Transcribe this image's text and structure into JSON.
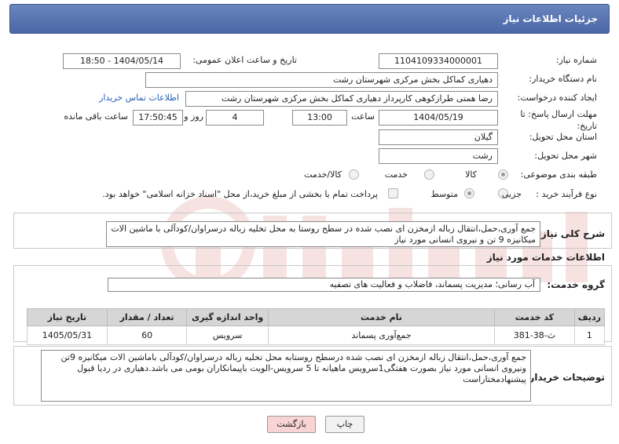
{
  "header": {
    "title": "جزئیات اطلاعات نیاز"
  },
  "form": {
    "need_number_label": "شماره نیاز:",
    "need_number": "1104109334000001",
    "announce_label": "تاریخ و ساعت اعلان عمومی:",
    "announce_value": "1404/05/14 - 18:50",
    "buyer_org_label": "نام دستگاه خریدار:",
    "buyer_org": "دهیاری کماکل بخش مرکزی شهرستان رشت",
    "creator_label": "ایجاد کننده درخواست:",
    "creator": "رضا همتی طرازکوهی کارپرداز دهیاری کماکل بخش مرکزی شهرستان رشت",
    "contact_link": "اطلاعات تماس خریدار",
    "deadline_label": "مهلت ارسال پاسخ: تا تاریخ:",
    "deadline_date": "1404/05/19",
    "time_label": "ساعت",
    "deadline_time": "13:00",
    "days_value": "4",
    "days_label": "روز و",
    "remaining_time": "17:50:45",
    "remaining_label": "ساعت باقی مانده",
    "province_label": "استان محل تحویل:",
    "province": "گیلان",
    "city_label": "شهر محل تحویل:",
    "city": "رشت",
    "category_label": "طبقه بندی موضوعی:",
    "category_options": [
      "کالا",
      "خدمت",
      "کالا/خدمت"
    ],
    "process_label": "نوع فرآیند خرید :",
    "process_options": [
      "جزیی",
      "متوسط"
    ],
    "payment_note": "پرداخت تمام یا بخشی از مبلغ خرید،از محل \"اسناد خزانه اسلامی\" خواهد بود."
  },
  "summary": {
    "label": "شرح کلی نیاز:",
    "text": "جمع آوری،حمل،انتقال زباله ازمخزن ای نصب شده در سطح روستا به محل تخلیه زباله درسراوان/کودآلی با ماشین الات میکانیزه 9 تن و نیروی انسانی مورد نیاز"
  },
  "services": {
    "section_title": "اطلاعات خدمات مورد نیاز",
    "group_label": "گروه خدمت:",
    "group_value": "آب رسانی؛ مدیریت پسماند، فاضلاب و فعالیت های تصفیه",
    "columns": [
      "ردیف",
      "کد خدمت",
      "نام خدمت",
      "واحد اندازه گیری",
      "تعداد / مقدار",
      "تاریخ نیاز"
    ],
    "rows": [
      {
        "index": "1",
        "code": "ث-38-381",
        "name": "جمع‌آوری پسماند",
        "unit": "سرویس",
        "qty": "60",
        "date": "1405/05/31"
      }
    ]
  },
  "buyer_notes": {
    "label": "توضیحات خریدار:",
    "text": "جمع آوری،حمل،انتقال زباله ازمخزن ای نصب شده درسطح روستابه محل تخلیه زباله درسراوان/کودآلی باماشین الات میکانیزه 9تن ونیروی انسانی مورد نیاز بصورت هفتگی1سرویس ماهیانه تا 5 سرویس-الویت باپیمانکاران بومی می باشد.دهیاری در ردیا قبول پیشنهادمختاراست"
  },
  "buttons": {
    "print": "چاپ",
    "back": "بازگشت"
  },
  "colors": {
    "header_bg": "#5a76b2",
    "link": "#2a62b9",
    "back_btn_bg": "#f9d4d4"
  }
}
